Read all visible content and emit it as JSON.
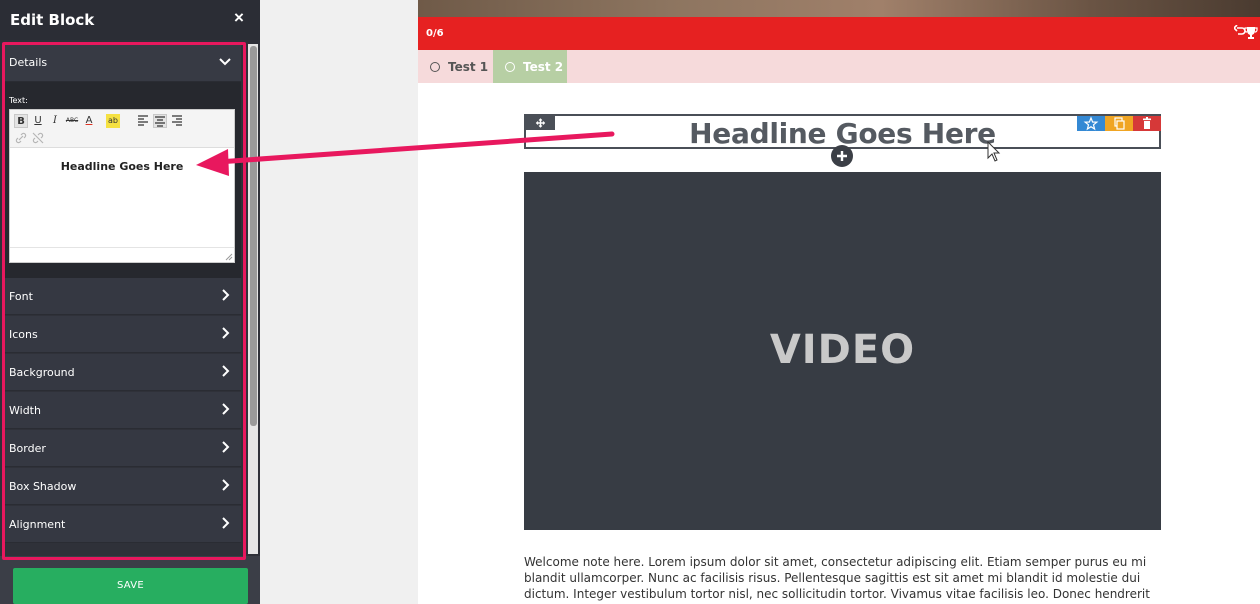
{
  "panel": {
    "title": "Edit Block",
    "close_glyph": "×",
    "sections": {
      "details": "Details",
      "font": "Font",
      "icons": "Icons",
      "background": "Background",
      "width": "Width",
      "border": "Border",
      "box_shadow": "Box Shadow",
      "alignment": "Alignment"
    },
    "text_label": "Text:",
    "editor_text": "Headline Goes Here",
    "toolbar": {
      "bold": "B",
      "underline": "U",
      "italic": "I",
      "strike": "ABC",
      "font_color": "A",
      "highlight": "ab"
    },
    "save_label": "SAVE"
  },
  "preview": {
    "progress": "0/6",
    "tabs": [
      {
        "label": "Test 1"
      },
      {
        "label": "Test 2"
      }
    ],
    "headline": "Headline Goes Here",
    "video_label": "VIDEO",
    "body_text": "Welcome note here. Lorem ipsum dolor sit amet, consectetur adipiscing elit. Etiam semper purus eu mi blandit ullamcorper. Nunc ac facilisis risus. Pellentesque sagittis est sit amet mi blandit id molestie dui dictum. Integer vestibulum tortor nisl, nec sollicitudin tortor. Vivamus vitae facilisis leo. Donec hendrerit aliquam neque vel"
  },
  "colors": {
    "accent_red": "#e62121",
    "highlight_pink": "#e8185e",
    "save_green": "#27ae60",
    "active_tab": "#b7cfa4"
  },
  "icons": [
    "close-icon",
    "chevron-down-icon",
    "chevron-right-icon",
    "undo-icon",
    "trophy-icon",
    "move-icon",
    "star-icon",
    "copy-icon",
    "trash-icon",
    "plus-icon"
  ]
}
